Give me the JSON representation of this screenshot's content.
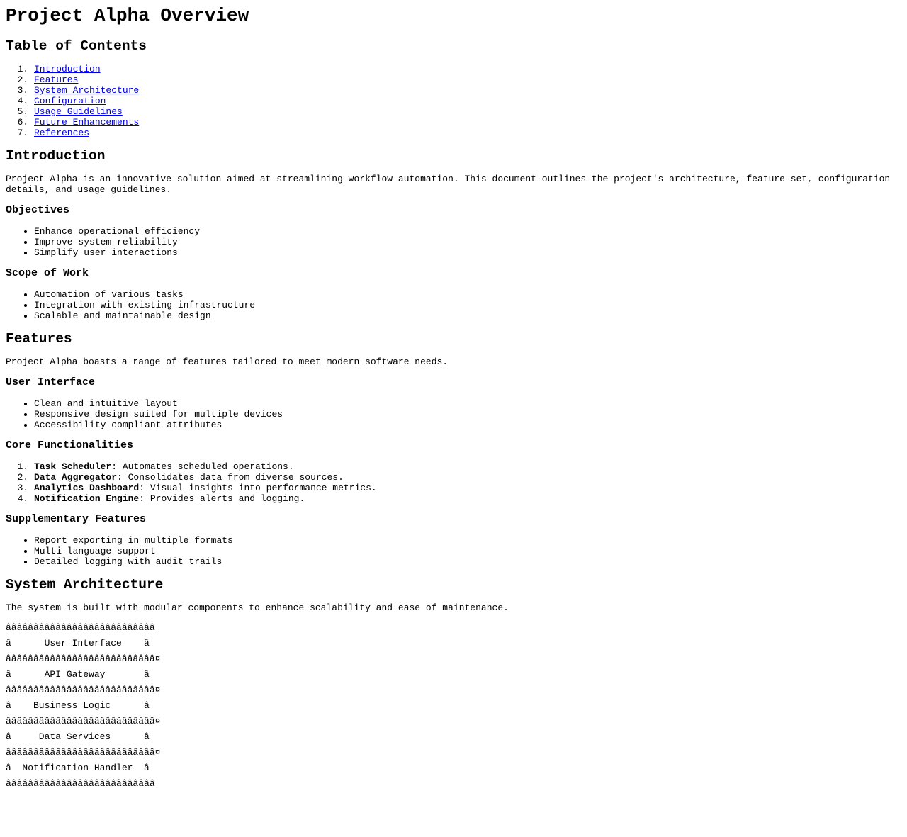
{
  "title": "Project Alpha Overview",
  "toc": {
    "heading": "Table of Contents",
    "items": [
      "Introduction",
      "Features",
      "System Architecture",
      "Configuration",
      "Usage Guidelines",
      "Future Enhancements",
      "References"
    ]
  },
  "introduction": {
    "heading": "Introduction",
    "text": "Project Alpha is an innovative solution aimed at streamlining workflow automation. This document outlines the project's architecture, feature set, configuration details, and usage guidelines.",
    "objectives": {
      "heading": "Objectives",
      "items": [
        "Enhance operational efficiency",
        "Improve system reliability",
        "Simplify user interactions"
      ]
    },
    "scope": {
      "heading": "Scope of Work",
      "items": [
        "Automation of various tasks",
        "Integration with existing infrastructure",
        "Scalable and maintainable design"
      ]
    }
  },
  "features": {
    "heading": "Features",
    "text": "Project Alpha boasts a range of features tailored to meet modern software needs.",
    "ui": {
      "heading": "User Interface",
      "items": [
        "Clean and intuitive layout",
        "Responsive design suited for multiple devices",
        "Accessibility compliant attributes"
      ]
    },
    "core": {
      "heading": "Core Functionalities",
      "items": [
        {
          "name": "Task Scheduler",
          "desc": ": Automates scheduled operations."
        },
        {
          "name": "Data Aggregator",
          "desc": ": Consolidates data from diverse sources."
        },
        {
          "name": "Analytics Dashboard",
          "desc": ": Visual insights into performance metrics."
        },
        {
          "name": "Notification Engine",
          "desc": ": Provides alerts and logging."
        }
      ]
    },
    "supplementary": {
      "heading": "Supplementary Features",
      "items": [
        "Report exporting in multiple formats",
        "Multi-language support",
        "Detailed logging with audit trails"
      ]
    }
  },
  "architecture": {
    "heading": "System Architecture",
    "text": "The system is built with modular components to enhance scalability and ease of maintenance.",
    "diagram": [
      "âââââââââââââââââââââââââââ",
      "â      User Interface    â",
      "âââââââââââââââââââââââââââ¤",
      "â      API Gateway       â",
      "âââââââââââââââââââââââââââ¤",
      "â    Business Logic      â",
      "âââââââââââââââââââââââââââ¤",
      "â     Data Services      â",
      "âââââââââââââââââââââââââââ¤",
      "â  Notification Handler  â",
      "âââââââââââââââââââââââââââ"
    ]
  }
}
